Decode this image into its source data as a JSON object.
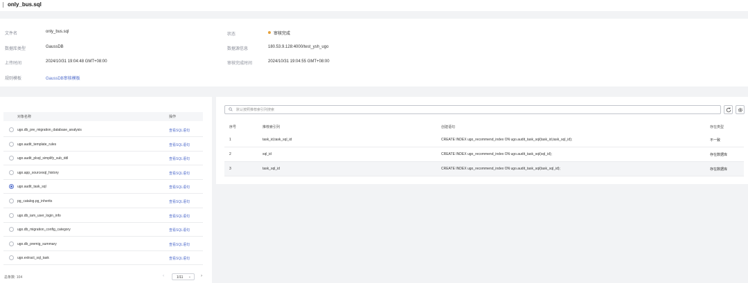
{
  "header": {
    "title": "only_bus.sql"
  },
  "info": {
    "file_name_label": "文件名",
    "file_name": "only_bus.sql",
    "db_type_label": "数据库类型",
    "db_type": "GaussDB",
    "upload_time_label": "上传时间",
    "upload_time": "2024/10/31 19:04:48 GMT+08:00",
    "template_label": "规则模板",
    "template": "GaussDB审核模板",
    "status_label": "状态",
    "status": "审核完成",
    "status_color": "#e6a23c",
    "connection_label": "数据源信息",
    "connection": "180.53.9.128:4000/test_ysh_ugo",
    "finish_time_label": "审核完成时间",
    "finish_time": "2024/10/31 19:04:55 GMT+08:00"
  },
  "objects": {
    "col_name": "对象名称",
    "col_op": "操作",
    "link_label": "查看SQL语句",
    "rows": [
      {
        "name": "ugo.db_pre_migration_database_analysis",
        "selected": false
      },
      {
        "name": "ugo.audit_template_rules",
        "selected": false
      },
      {
        "name": "ugo.audit_plsql_simplify_sub_ddl",
        "selected": false
      },
      {
        "name": "ugo.app_sourcesql_history",
        "selected": false
      },
      {
        "name": "ugo.audit_task_sql",
        "selected": true
      },
      {
        "name": "pg_catalog.pg_inherits",
        "selected": false
      },
      {
        "name": "ugo.db_iam_user_login_info",
        "selected": false
      },
      {
        "name": "ugo.db_migration_config_category",
        "selected": false
      },
      {
        "name": "ugo.db_premig_summary",
        "selected": false
      },
      {
        "name": "ugo.extract_sql_task",
        "selected": false
      }
    ],
    "total": "总条数: 104",
    "page": "1/11"
  },
  "index": {
    "search_placeholder": "默认按照推荐索引列搜索",
    "columns": [
      "序号",
      "推荐索引列",
      "创建语句",
      "存在类型"
    ],
    "rows": [
      [
        "1",
        "task_id,task_sql_id",
        "CREATE INDEX ugo_recommend_index ON ugo.audit_task_sql(task_id,task_sql_id);",
        "不一致"
      ],
      [
        "2",
        "sql_id",
        "CREATE INDEX ugo_recommend_index ON ugo.audit_task_sql(sql_id);",
        "存在数据库"
      ],
      [
        "3",
        "task_sql_id",
        "CREATE INDEX ugo_recommend_index ON ugo.audit_task_sql(task_sql_id);",
        "存在数据库"
      ]
    ]
  },
  "icons": {
    "search": "search-icon",
    "refresh": "refresh-icon",
    "settings": "gear-icon"
  },
  "accent_color": "#526ecc"
}
